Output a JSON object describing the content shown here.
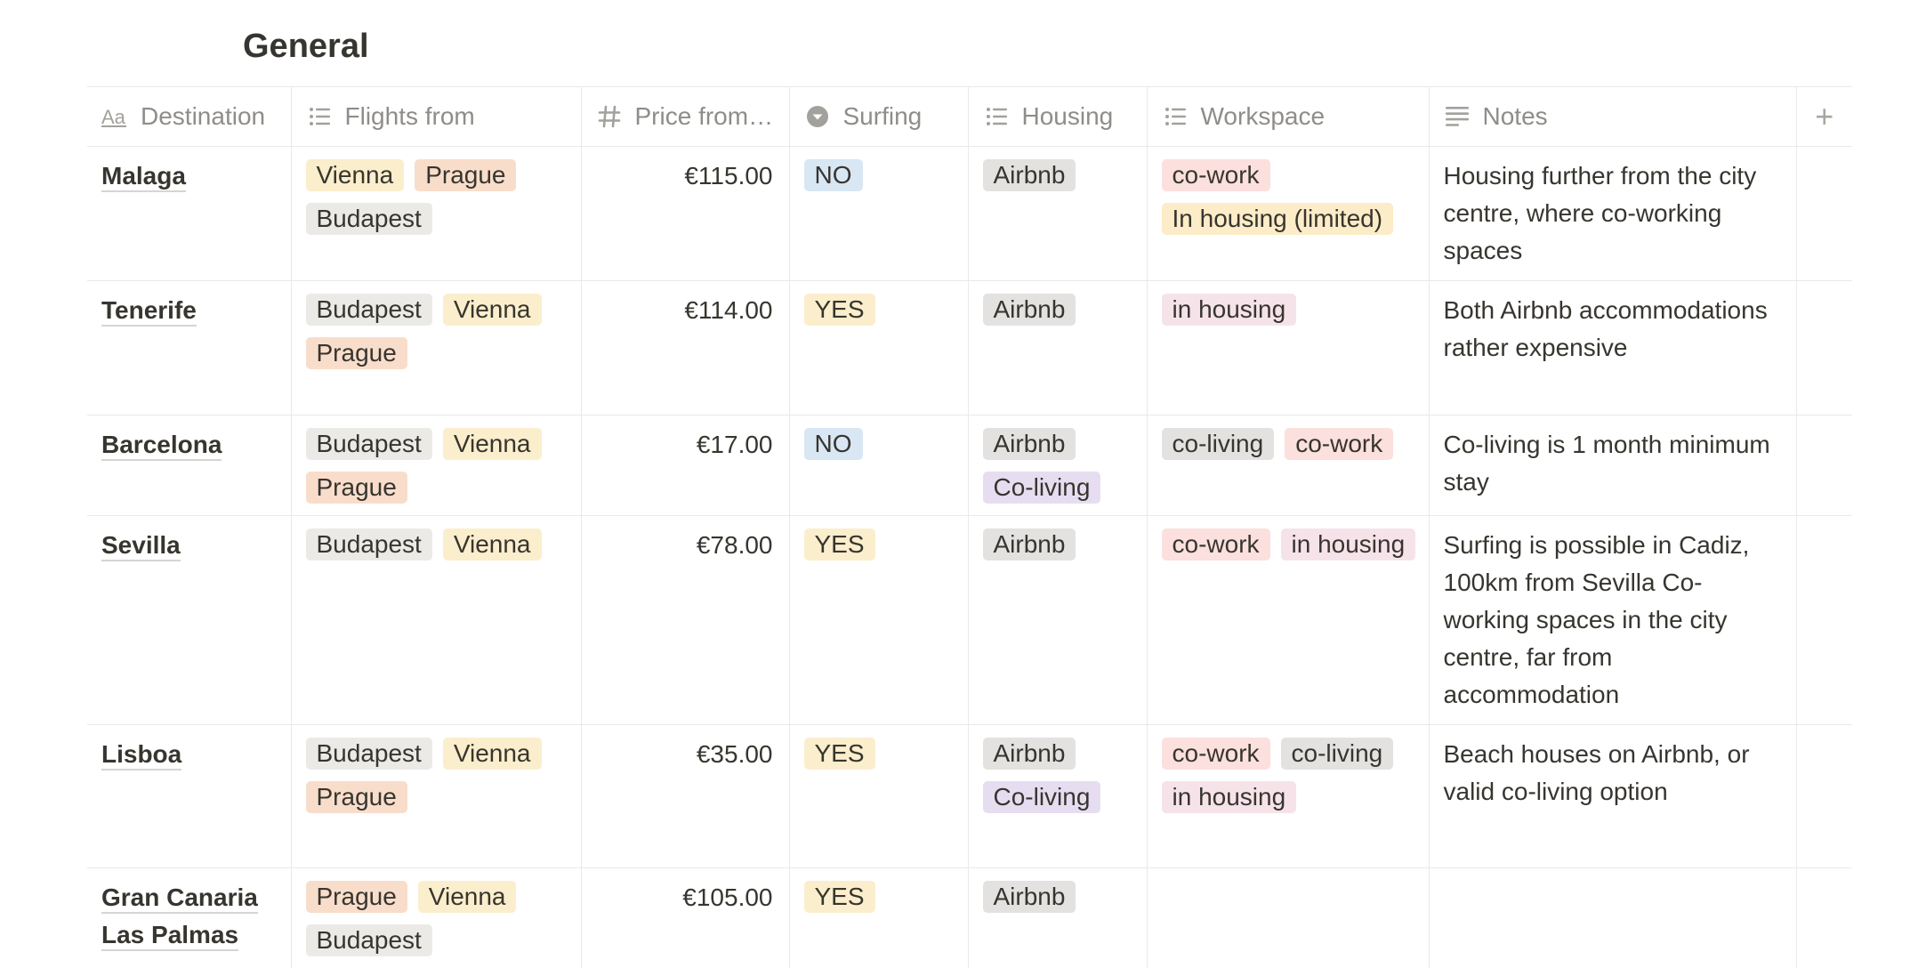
{
  "view": {
    "title": "General"
  },
  "columns": {
    "destination": "Destination",
    "flights": "Flights from",
    "price": "Price from…",
    "surfing": "Surfing",
    "housing": "Housing",
    "workspace": "Workspace",
    "notes": "Notes",
    "add": "+"
  },
  "icons": {
    "destination": "text-aa-icon",
    "flights": "multi-select-list-icon",
    "price": "number-hash-icon",
    "surfing": "select-chevron-icon",
    "housing": "multi-select-list-icon",
    "workspace": "multi-select-list-icon",
    "notes": "text-lines-icon"
  },
  "tag_colors": {
    "Vienna": "#fbeecc",
    "Prague": "#f9ddcb",
    "Budapest": "#eceae7",
    "NO": "#d8e7f3",
    "YES": "#fbeecc",
    "Airbnb": "#e3e2e0",
    "Co-living": "#e6def0",
    "co-work": "#fbe0dd",
    "co-living": "#e3e2e0",
    "in housing": "#f6e3ea",
    "In housing (limited)": "#fdecc8"
  },
  "rows": [
    {
      "destination": "Malaga",
      "flights": [
        "Vienna",
        "Prague",
        "Budapest"
      ],
      "price": "€115.00",
      "surfing": "NO",
      "housing": [
        "Airbnb"
      ],
      "workspace": [
        "co-work",
        "In housing (limited)"
      ],
      "notes": "Housing further from the city centre, where co-working spaces"
    },
    {
      "destination": "Tenerife",
      "flights": [
        "Budapest",
        "Vienna",
        "Prague"
      ],
      "price": "€114.00",
      "surfing": "YES",
      "housing": [
        "Airbnb"
      ],
      "workspace": [
        "in housing"
      ],
      "notes": "Both Airbnb accommodations rather expensive"
    },
    {
      "destination": "Barcelona",
      "flights": [
        "Budapest",
        "Vienna",
        "Prague"
      ],
      "price": "€17.00",
      "surfing": "NO",
      "housing": [
        "Airbnb",
        "Co-living"
      ],
      "workspace": [
        "co-living",
        "co-work"
      ],
      "notes": "Co-living is 1 month minimum stay"
    },
    {
      "destination": "Sevilla",
      "flights": [
        "Budapest",
        "Vienna"
      ],
      "price": "€78.00",
      "surfing": "YES",
      "housing": [
        "Airbnb"
      ],
      "workspace": [
        "co-work",
        "in housing"
      ],
      "notes": "Surfing is possible in Cadiz, 100km from Sevilla Co-working spaces in the city centre, far from accommodation"
    },
    {
      "destination": "Lisboa",
      "flights": [
        "Budapest",
        "Vienna",
        "Prague"
      ],
      "price": "€35.00",
      "surfing": "YES",
      "housing": [
        "Airbnb",
        "Co-living"
      ],
      "workspace": [
        "co-work",
        "co-living",
        "in housing"
      ],
      "notes": "Beach houses on Airbnb, or valid co-living option"
    },
    {
      "destination": "Gran Canaria Las Palmas",
      "flights": [
        "Prague",
        "Vienna",
        "Budapest"
      ],
      "price": "€105.00",
      "surfing": "YES",
      "housing": [
        "Airbnb"
      ],
      "workspace": [],
      "notes": ""
    }
  ]
}
